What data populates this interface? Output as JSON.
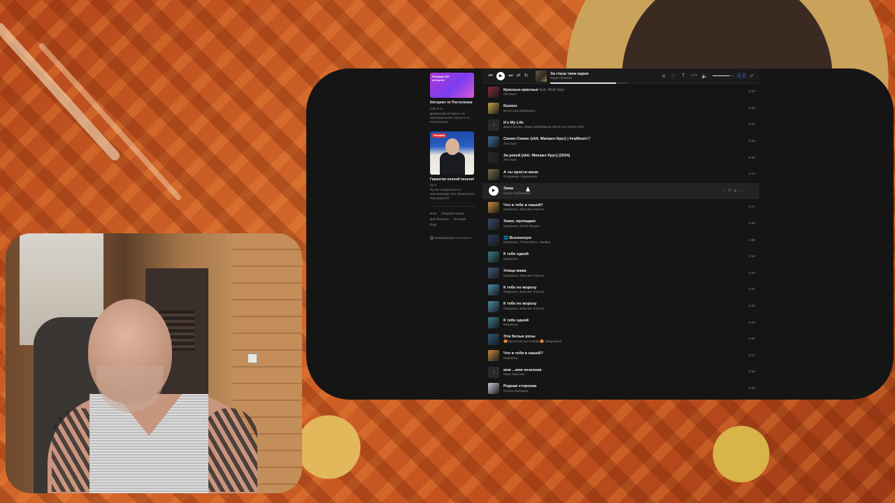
{
  "player": {
    "now_playing_title": "За глаза твои карие",
    "now_playing_artist": "Раден Вовков",
    "progress": 0.85,
    "time": "1:34",
    "volume": 0.8,
    "icons": [
      "prev-icon",
      "play-icon",
      "next-icon",
      "shuffle-icon",
      "repeat-icon",
      "dislike-icon",
      "like-icon",
      "lyrics-icon",
      "volume-icon",
      "broadcast-icon",
      "share-icon"
    ]
  },
  "ads": [
    {
      "image_text": "Реклама·18+ интернет",
      "title": "Интернет от Ростелеком",
      "domain": "msk.rt.ru",
      "description": "Домашний интернет на максимальной скорости от Ростелеком"
    },
    {
      "badge": "Реклама",
      "title": "Гарантия полной пенсии!",
      "domain": "rg.ru",
      "description": "Путин позаботился о пенсионерах: все накопления под защитой"
    }
  ],
  "footer": {
    "links": [
      "Блог",
      "Разработчикам",
      "Для бизнеса",
      "Авторам",
      "Ещё"
    ],
    "info": "Информация о контенте"
  },
  "tracks": [
    {
      "title": "Красные-красные",
      "feat": "feat. Мой Круг",
      "artist": "Лесоцин",
      "duration": "4:10",
      "thumb": "#8a2838"
    },
    {
      "title": "Казино",
      "feat": "",
      "artist": "Вячеслав Добрынин",
      "duration": "4:16",
      "thumb": "#c9a24a"
    },
    {
      "title": "It's My Life",
      "feat": "",
      "artist": "Дима Билан, Марк Крайвбауэр Silver Ace Radio Edit",
      "duration": "2:57",
      "thumb": "note"
    },
    {
      "title": "Синие-Синие (skit. Михаил Круг) | #vqMusic♡",
      "feat": "",
      "artist": "Лесоцин",
      "duration": "4:15",
      "thumb": "#3a6a9a"
    },
    {
      "title": "За рекой [skit. Михаил Круг] (2024)",
      "feat": "",
      "artist": "Лесоцин",
      "duration": "5:31",
      "thumb": "#2a2a2a"
    },
    {
      "title": "А ты прости меня",
      "feat": "",
      "artist": "Владимир Ждамиров",
      "duration": "4:14",
      "thumb": "#7a6a4a"
    },
    {
      "title": "Зима",
      "feat": "",
      "artist": "Ольга Рыбникова",
      "duration": "",
      "thumb": "playing"
    },
    {
      "title": "Что в тебе в нашей?",
      "feat": "",
      "artist": "Маракеш, Максим Апрель",
      "duration": "2:17",
      "thumb": "#c98a3a"
    },
    {
      "title": "Знаю, пропадаю",
      "feat": "",
      "artist": "Маракеш, Maria Bergen",
      "duration": "2:45",
      "thumb": "#3a4a6a"
    },
    {
      "title": "🌐 Вселенную",
      "feat": "",
      "artist": "Маракеш, TRUEзвень, Мафик",
      "duration": "4:48",
      "thumb": "#2a3a5a"
    },
    {
      "title": "К тебе одной",
      "feat": "",
      "artist": "Маракеш",
      "duration": "3:12",
      "thumb": "#3a7a8a"
    },
    {
      "title": "Улица мама",
      "feat": "",
      "artist": "Маракеш, Максим Апрель",
      "duration": "2:23",
      "thumb": "#3a5a7a"
    },
    {
      "title": "К тебе по морозу",
      "feat": "",
      "artist": "Маракеш, Максим Апрель",
      "duration": "2:41",
      "thumb": "#4a8aaa"
    },
    {
      "title": "К тебе по морозу",
      "feat": "",
      "artist": "Маракеш, Максим Апрель",
      "duration": "2:41",
      "thumb": "#4a8aaa"
    },
    {
      "title": "К тебе одной",
      "feat": "",
      "artist": "Маракеш",
      "duration": "3:12",
      "thumb": "#3a7a8a"
    },
    {
      "title": "Эти белые розы",
      "feat": "",
      "artist": "😍Музончик для кайфа😍 (Маракеш)",
      "duration": "2:57",
      "thumb": "#2a5a7a"
    },
    {
      "title": "Что в тебя в нашей?",
      "feat": "",
      "artist": "Маракеш",
      "duration": "2:17",
      "thumb": "#c98a3a"
    },
    {
      "title": "моя ...моя незенная",
      "feat": "",
      "artist": "Макс Барских",
      "duration": "3:42",
      "thumb": "note"
    },
    {
      "title": "Родная сторонка",
      "feat": "",
      "artist": "Елена Любарец",
      "duration": "3:40",
      "thumb": "#c8c8d8"
    }
  ]
}
